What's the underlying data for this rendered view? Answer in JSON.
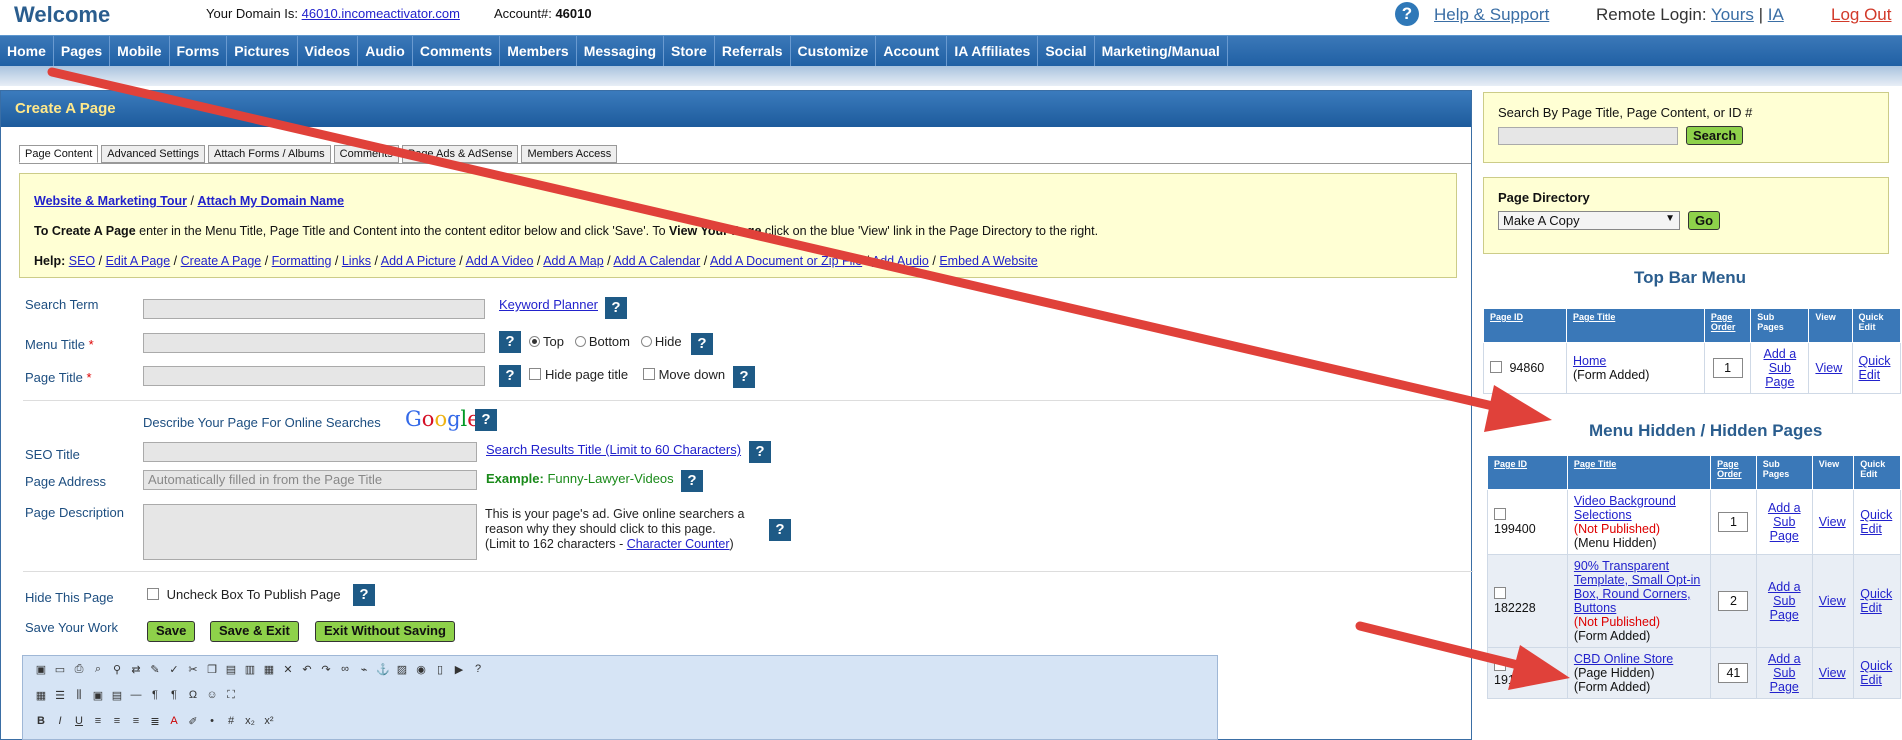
{
  "header": {
    "welcome": "Welcome",
    "domain_label": "Your Domain Is:",
    "domain_link": "46010.incomeactivator.com",
    "account_label": "Account#:",
    "account_number": "46010",
    "help_icon": "?",
    "help_label": "Help & Support",
    "remote_label": "Remote Login:",
    "remote_yours": "Yours",
    "remote_sep": "|",
    "remote_ia": "IA",
    "logout": "Log Out"
  },
  "nav": [
    "Home",
    "Pages",
    "Mobile",
    "Forms",
    "Pictures",
    "Videos",
    "Audio",
    "Comments",
    "Members",
    "Messaging",
    "Store",
    "Referrals",
    "Customize",
    "Account",
    "IA Affiliates",
    "Social",
    "Marketing/Manual"
  ],
  "main": {
    "title": "Create A Page",
    "tabs": [
      "Page Content",
      "Advanced Settings",
      "Attach Forms / Albums",
      "Comments",
      "Page Ads & AdSense",
      "Members Access"
    ],
    "info": {
      "tour": "Website & Marketing Tour",
      "sep": "/",
      "attach": "Attach My Domain Name",
      "line2_bold1": "To Create A Page",
      "line2_text1": " enter in the Menu Title, Page Title and Content into the content editor below and click 'Save'. To ",
      "line2_bold2": "View Your Page",
      "line2_text2": " click on the blue 'View' link in the Page Directory to the right.",
      "help_label": "Help:",
      "help_links": [
        "SEO",
        "Edit A Page",
        "Create A Page",
        "Formatting",
        "Links",
        "Add A Picture",
        "Add A Video",
        "Add A Map",
        "Add A Calendar",
        "Add A Document or Zip File",
        "Add Audio",
        "Embed A Website"
      ]
    },
    "search_term_label": "Search Term",
    "keyword_planner": "Keyword Planner",
    "menu_title_label": "Menu Title",
    "page_title_label": "Page Title",
    "req": "*",
    "q": "?",
    "radio_top": "Top",
    "radio_bottom": "Bottom",
    "radio_hide": "Hide",
    "hide_page_title": "Hide page title",
    "move_down": "Move down",
    "describe": "Describe Your Page For Online Searches",
    "google": "Google",
    "seo_title_label": "SEO Title",
    "seo_results_link": "Search Results Title (Limit to 60 Characters)",
    "page_address_label": "Page Address",
    "page_address_placeholder": "Automatically filled in from the Page Title",
    "example_label": "Example:",
    "example_value": "Funny-Lawyer-Videos",
    "page_desc_label": "Page Description",
    "page_desc_help1": "This is your page's ad. Give online searchers a",
    "page_desc_help2": "reason why they should click to this page.",
    "page_desc_help3": "(Limit to 162 characters - ",
    "char_counter": "Character Counter",
    "page_desc_help4": ")",
    "hide_this_page_label": "Hide This Page",
    "uncheck_text": "Uncheck Box To Publish Page",
    "save_work_label": "Save Your Work",
    "save_btn": "Save",
    "save_exit_btn": "Save & Exit",
    "exit_btn": "Exit Without Saving"
  },
  "sidebar": {
    "search_label": "Search By Page Title, Page Content, or ID #",
    "search_btn": "Search",
    "directory_label": "Page Directory",
    "directory_selected": "Make A Copy",
    "go_btn": "Go",
    "top_bar_title": "Top Bar Menu",
    "hidden_title": "Menu Hidden / Hidden Pages",
    "cols": [
      "Page ID",
      "Page Title",
      "Page Order",
      "Sub Pages",
      "View",
      "Quick Edit"
    ],
    "top_rows": [
      {
        "id": "94860",
        "title": "Home",
        "status": "(Form Added)",
        "order": "1",
        "sub": "Add a Sub Page",
        "view": "View",
        "edit": "Quick Edit"
      }
    ],
    "hidden_rows": [
      {
        "id": "199400",
        "title": "Video Background Selections",
        "status1": "(Not Published)",
        "status2": "(Menu Hidden)",
        "order": "1",
        "sub": "Add a Sub Page",
        "view": "View",
        "edit": "Quick Edit"
      },
      {
        "id": "182228",
        "title": "90% Transparent Template, Small Opt-in Box, Round Corners, Buttons",
        "status1": "(Not Published)",
        "status2": "(Form Added)",
        "order": "2",
        "sub": "Add a Sub Page",
        "view": "View",
        "edit": "Quick Edit"
      },
      {
        "id": "191484",
        "title": "CBD Online Store",
        "status1": "(Page Hidden)",
        "status2": "(Form Added)",
        "order": "41",
        "sub": "Add a Sub Page",
        "view": "View",
        "edit": "Quick Edit"
      }
    ]
  },
  "colors": {
    "nav": "#2a66a8",
    "accent_yellow": "#ffffd4",
    "annotation_arrow": "#e0413a",
    "button_green": "#8ed14a"
  }
}
